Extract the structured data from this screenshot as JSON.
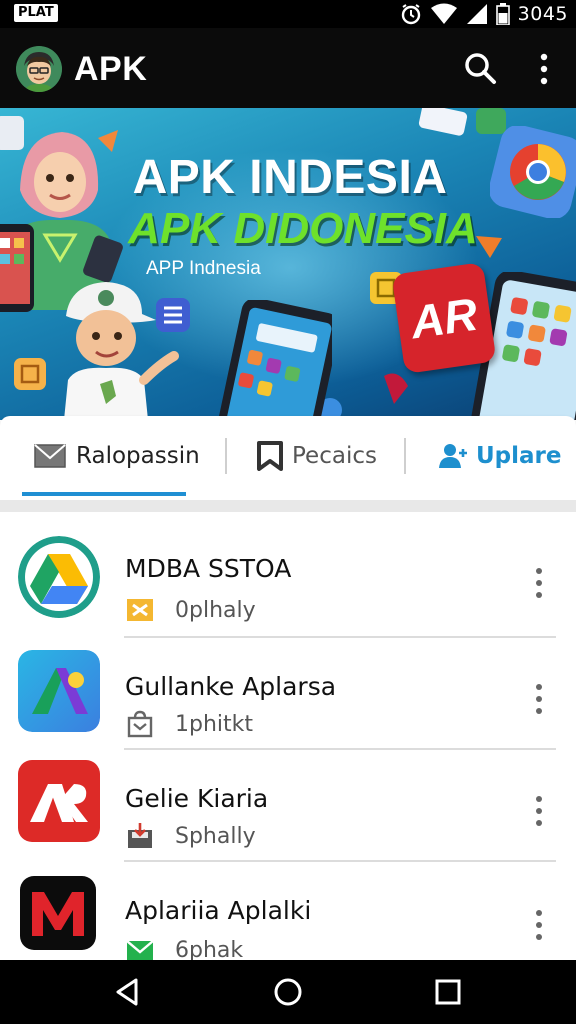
{
  "status_bar": {
    "carrier_badge": "PLAT",
    "time": "3045",
    "icons": [
      "alarm-icon",
      "wifi-icon",
      "signal-icon",
      "battery-icon"
    ]
  },
  "app_bar": {
    "title": "APK",
    "logo_icon": "avatar-logo-icon",
    "actions": [
      "search-icon",
      "more-vert-icon"
    ]
  },
  "banner": {
    "title": "APK INDESIA",
    "subtitle": "APK DIDONESIA",
    "caption": "APP Indnesia",
    "logo_badge": "AR"
  },
  "tabs": [
    {
      "label": "Ralopassin",
      "icon": "mail-icon",
      "selected": true
    },
    {
      "label": "Pecaics",
      "icon": "bookmark-icon",
      "selected": false
    },
    {
      "label": "Uplare",
      "icon": "person-add-icon",
      "selected": false
    }
  ],
  "apps": [
    {
      "name": "MDBA SSTOA",
      "meta": "0plhaly",
      "icon": "drive-icon",
      "meta_icon": "badge-x-icon"
    },
    {
      "name": "Gullanke Aplarsa",
      "meta": "1phitkt",
      "icon": "app-a-icon",
      "meta_icon": "bag-icon"
    },
    {
      "name": "Gelie Kiaria",
      "meta": "Sphally",
      "icon": "ar-icon",
      "meta_icon": "download-box-icon"
    },
    {
      "name": "Aplariia Aplalki",
      "meta": "6phak",
      "icon": "m-icon",
      "meta_icon": "mail-green-icon"
    }
  ],
  "colors": {
    "accent": "#1f8fd3",
    "banner_subtitle": "#6ee12b",
    "app_bar": "#0b0b0b"
  },
  "nav_bar": {
    "buttons": [
      "back-icon",
      "home-icon",
      "recents-icon"
    ]
  }
}
